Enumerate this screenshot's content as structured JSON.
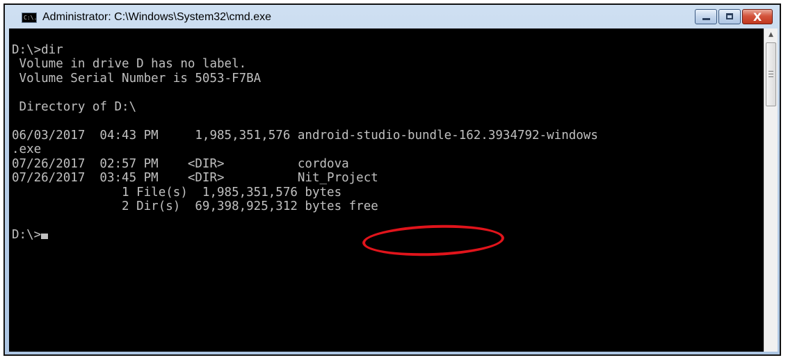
{
  "window": {
    "title": "Administrator: C:\\Windows\\System32\\cmd.exe",
    "icon_text": "C:\\.",
    "buttons": {
      "close_label": "X"
    }
  },
  "console": {
    "lines": [
      "",
      "D:\\>dir",
      " Volume in drive D has no label.",
      " Volume Serial Number is 5053-F7BA",
      "",
      " Directory of D:\\",
      "",
      "06/03/2017  04:43 PM     1,985,351,576 android-studio-bundle-162.3934792-windows",
      ".exe",
      "07/26/2017  02:57 PM    <DIR>          cordova",
      "07/26/2017  03:45 PM    <DIR>          Nit_Project",
      "               1 File(s)  1,985,351,576 bytes",
      "               2 Dir(s)  69,398,925,312 bytes free",
      "",
      "D:\\>"
    ]
  },
  "scrollbar": {
    "up_arrow": "▲"
  },
  "colors": {
    "console_bg": "#000000",
    "console_text": "#c0c0c0",
    "annotation": "#e0141b",
    "close_button": "#c0381f"
  }
}
